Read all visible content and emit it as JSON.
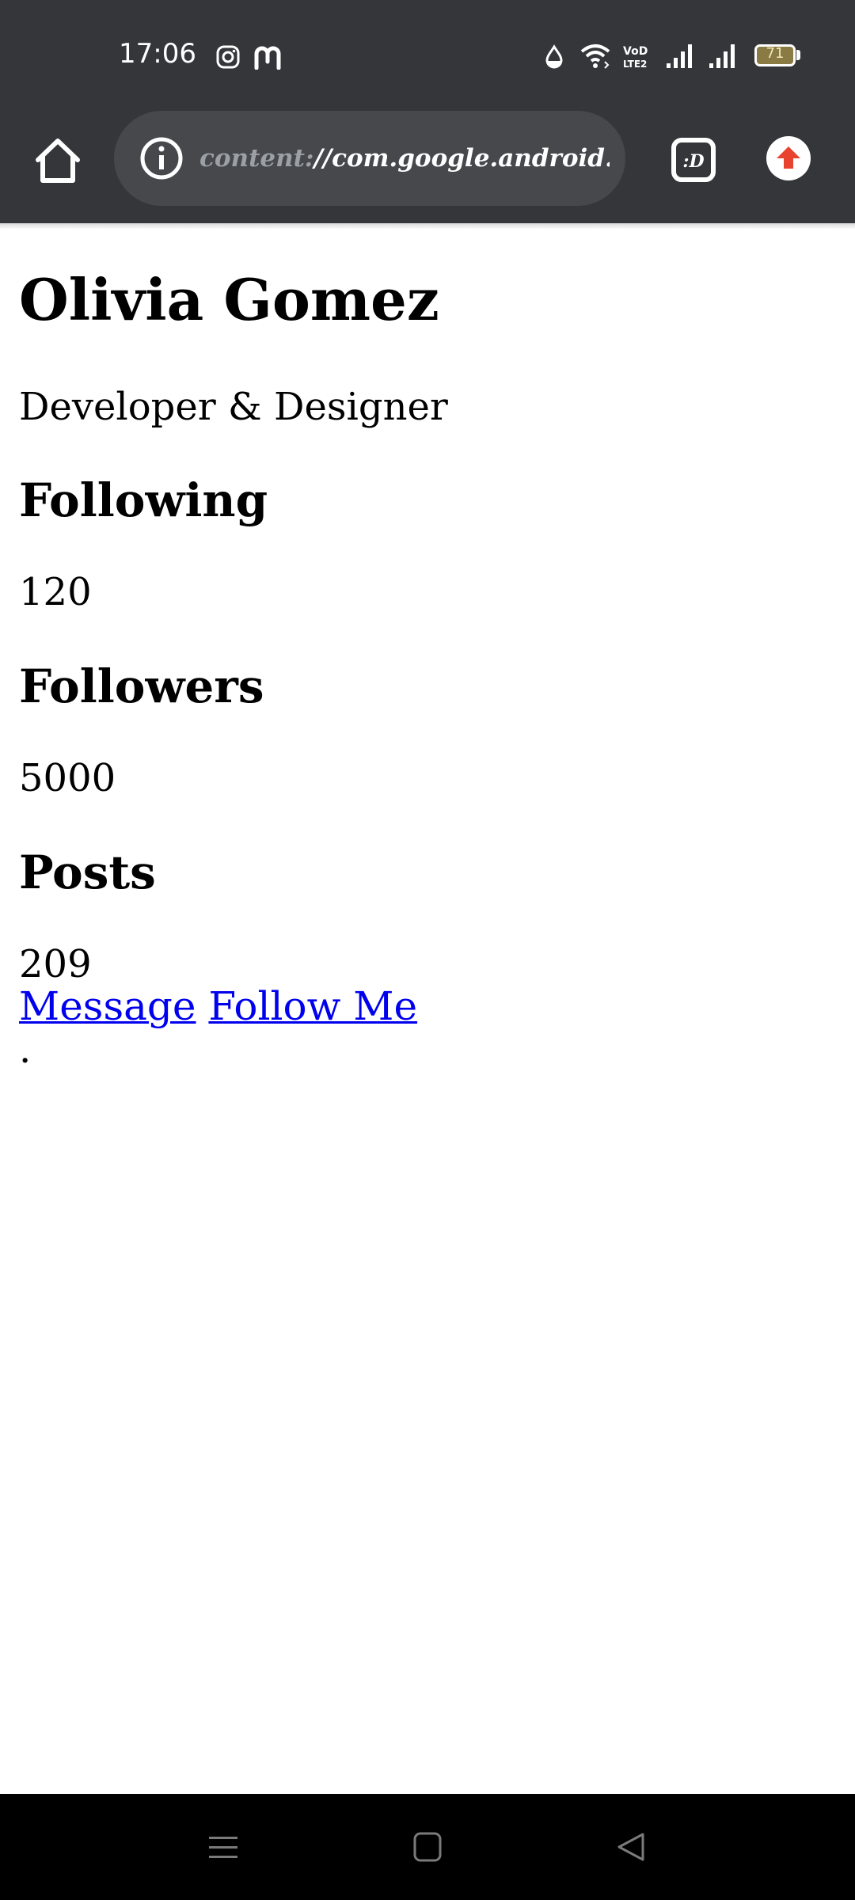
{
  "status_bar": {
    "time": "17:06",
    "notification_icons": [
      "instagram-icon",
      "mastodon-icon"
    ],
    "system_icons": [
      "data-saver-icon",
      "wifi-icon",
      "volte-icon",
      "signal-icon",
      "signal-icon"
    ],
    "battery": "71"
  },
  "browser": {
    "url_scheme": "content:",
    "url_rest": "//com.google.android.ap",
    "icons": [
      "home-icon",
      "info-icon",
      "tab-switcher-icon",
      "update-icon"
    ],
    "accent_color": "#e8432f"
  },
  "profile": {
    "name": "Olivia Gomez",
    "tagline": "Developer & Designer",
    "stats": [
      {
        "label": "Following",
        "value": "120"
      },
      {
        "label": "Followers",
        "value": "5000"
      },
      {
        "label": "Posts",
        "value": "209"
      }
    ],
    "links": {
      "message": "Message",
      "follow": "Follow Me"
    },
    "trailing": "."
  },
  "nav_bar": {
    "icons": [
      "recents-menu-icon",
      "home-square-icon",
      "back-triangle-icon"
    ]
  }
}
